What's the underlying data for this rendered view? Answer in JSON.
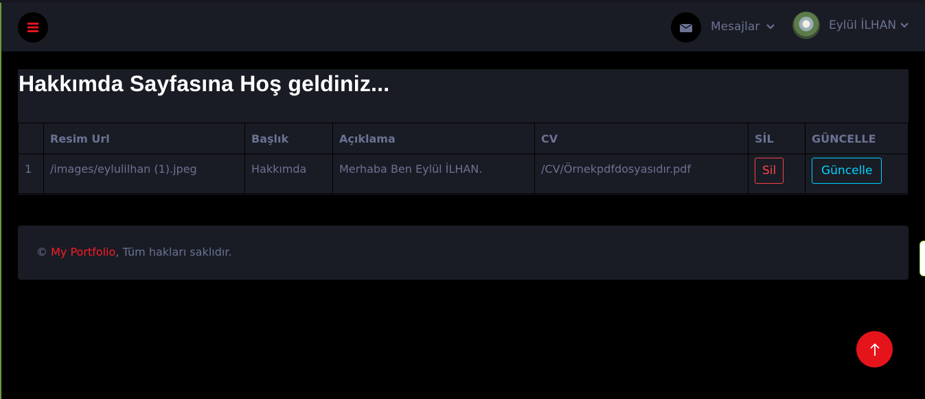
{
  "navbar": {
    "menu_icon": "bars-icon",
    "messages_icon": "envelope-icon",
    "messages_label": "Mesajlar",
    "user_name": "Eylül İLHAN"
  },
  "page": {
    "title": "Hakkımda Sayfasına Hoş geldiniz..."
  },
  "table": {
    "headers": [
      "",
      "Resim Url",
      "Başlık",
      "Açıklama",
      "CV",
      "SİL",
      "GÜNCELLE"
    ],
    "rows": [
      {
        "index": "1",
        "image_url": "/images/eylulilhan (1).jpeg",
        "title": "Hakkımda",
        "description": "Merhaba Ben Eylül İLHAN.",
        "cv": "/CV/Örnekpdfdosyasıdır.pdf",
        "delete_label": "Sil",
        "update_label": "Güncelle"
      }
    ]
  },
  "footer": {
    "copyright": "©",
    "link_text": "My Portfolio",
    "rest": ", Tüm hakları saklıdır."
  },
  "colors": {
    "accent_red": "#fc424a",
    "accent_cyan": "#00d2ff",
    "panel": "#191c24"
  }
}
